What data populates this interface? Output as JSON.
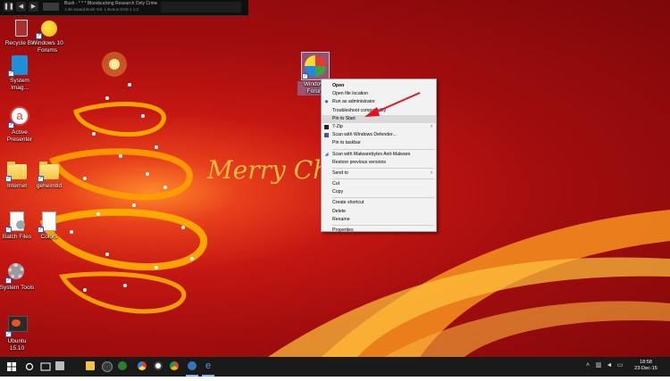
{
  "media_player": {
    "track_title": "Bush - * * * Bloodsucking Research Only Crime · Rock ·",
    "track_subtitle": "1:45    Sound Bush Vol. 1 Bonus DVD 1     1:2",
    "buttons": [
      "pause-icon",
      "previous-icon",
      "next-icon"
    ]
  },
  "desktop_icons": [
    {
      "label": "Recycle Bin",
      "icon": "recycle-bin-icon"
    },
    {
      "label": "Windows 10\nForums",
      "icon": "windows-orb-icon"
    },
    {
      "label": "System\nImag...",
      "icon": "system-image-icon"
    },
    {
      "label": "Active\nPresenter",
      "icon": "active-presenter-icon"
    },
    {
      "label": "Internet",
      "icon": "folder-icon"
    },
    {
      "label": "geheimtid",
      "icon": "folder-icon"
    },
    {
      "label": "Batch Files",
      "icon": "batch-files-icon"
    },
    {
      "label": "Colors",
      "icon": "document-icon"
    },
    {
      "label": "System Tools",
      "icon": "gear-icon"
    },
    {
      "label": "Ubuntu\n15.10",
      "icon": "ubuntu-icon"
    },
    {
      "label": "Windows\nForum",
      "icon": "windows-orb-icon"
    }
  ],
  "wallpaper_text": "Merry Ch",
  "context_menu": {
    "items": [
      {
        "label": "Open",
        "bold": true
      },
      {
        "label": "Open file location"
      },
      {
        "label": "Run as administrator",
        "icon": "shield-icon"
      },
      {
        "label": "Troubleshoot compatibility"
      },
      {
        "label": "Pin to Start",
        "highlighted": true
      },
      {
        "label": "7-Zip",
        "submenu": true,
        "icon": "7zip-icon"
      },
      {
        "label": "Scan with Windows Defender...",
        "icon": "defender-icon"
      },
      {
        "label": "Pin to taskbar"
      },
      {
        "label": "Scan with Malwarebytes Anti-Malware",
        "icon": "malwarebytes-icon"
      },
      {
        "label": "Restore previous versions"
      },
      {
        "label": "Send to",
        "submenu": true
      },
      {
        "label": "Cut"
      },
      {
        "label": "Copy"
      },
      {
        "label": "Create shortcut"
      },
      {
        "label": "Delete"
      },
      {
        "label": "Rename"
      },
      {
        "label": "Properties"
      }
    ]
  },
  "taskbar": {
    "start_icon": "windows-start-icon",
    "search_icon": "search-icon",
    "task_view_icon": "task-view-icon",
    "pinned": [
      "recycle-bin-icon",
      "file-explorer-icon",
      "media-player-icon",
      "xbox-icon",
      "paint-icon",
      "record-icon",
      "chrome-icon",
      "edge-icon",
      "internet-explorer-icon"
    ],
    "clock_time": "18:58",
    "clock_date": "23-Dec-15",
    "tray_icons": [
      "chevron-up-icon",
      "network-icon",
      "volume-icon",
      "notification-icon"
    ]
  },
  "colors": {
    "menu_highlight": "#d9d9d9",
    "taskbar": "#1a1a1a",
    "arrow": "#e0141e",
    "active_indicator": "#7ab4f5"
  }
}
